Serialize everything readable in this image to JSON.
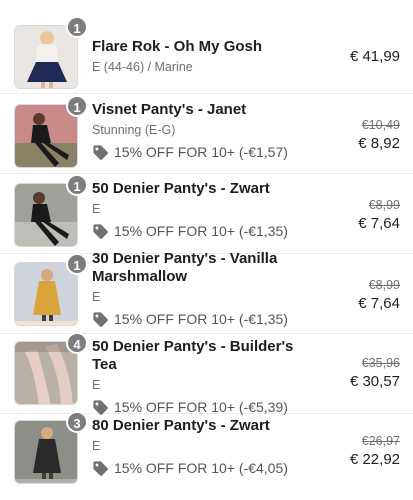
{
  "items": [
    {
      "quantity": "1",
      "name": "Flare Rok - Oh My Gosh",
      "variant": "E (44-46) / Marine",
      "discount": "",
      "old_price": "",
      "price": "€ 41,99",
      "thumb_icon": "product-photo-skirt-icon",
      "colors": {
        "bg": "#e9e6e4",
        "main": "#1f2a55",
        "accent": "#f4f1ee"
      }
    },
    {
      "quantity": "1",
      "name": "Visnet Panty's - Janet",
      "variant": "Stunning (E-G)",
      "discount": "15% OFF FOR 10+ (-€1,57)",
      "old_price": "€10,49",
      "price": "€ 8,92",
      "thumb_icon": "product-photo-tights-icon",
      "colors": {
        "bg": "#c98a88",
        "main": "#1a1a1a",
        "accent": "#6d7f57"
      }
    },
    {
      "quantity": "1",
      "name": "50 Denier Panty's - Zwart",
      "variant": "E",
      "discount": "15% OFF FOR 10+ (-€1,35)",
      "old_price": "€8,99",
      "price": "€ 7,64",
      "thumb_icon": "product-photo-tights-icon",
      "colors": {
        "bg": "#9fa29a",
        "main": "#1a1a1a",
        "accent": "#c9cbc3"
      }
    },
    {
      "quantity": "1",
      "name": "30 Denier Panty's - Vanilla Marshmallow",
      "variant": "E",
      "discount": "15% OFF FOR 10+ (-€1,35)",
      "old_price": "€8,99",
      "price": "€ 7,64",
      "thumb_icon": "product-photo-dress-icon",
      "colors": {
        "bg": "#cfd4dc",
        "main": "#d9a53a",
        "accent": "#f2e3cf"
      }
    },
    {
      "quantity": "4",
      "name": "50 Denier Panty's - Builder's Tea",
      "variant": "E",
      "discount": "15% OFF FOR 10+ (-€5,39)",
      "old_price": "€35,96",
      "price": "€ 30,57",
      "thumb_icon": "product-photo-legs-icon",
      "colors": {
        "bg": "#b9b0a6",
        "main": "#e8cfc3",
        "accent": "#8c7f73"
      }
    },
    {
      "quantity": "3",
      "name": "80 Denier Panty's - Zwart",
      "variant": "E",
      "discount": "15% OFF FOR 10+ (-€4,05)",
      "old_price": "€26,97",
      "price": "€ 22,92",
      "thumb_icon": "product-photo-dress-icon",
      "colors": {
        "bg": "#8e8e88",
        "main": "#2a2a2a",
        "accent": "#b0b0aa"
      }
    }
  ]
}
